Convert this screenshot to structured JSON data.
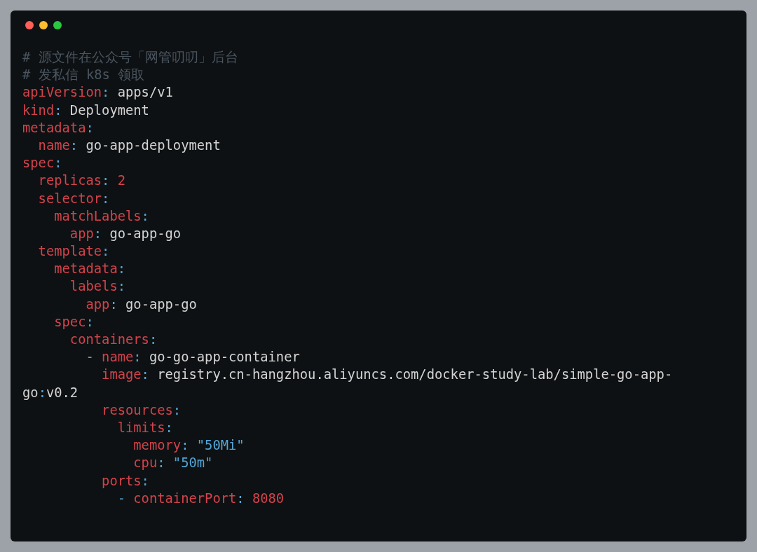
{
  "window": {
    "controls": [
      {
        "color": "#ff5f57"
      },
      {
        "color": "#febc2e"
      },
      {
        "color": "#28c840"
      }
    ]
  },
  "code_lines": [
    [
      {
        "kind": "comment",
        "text": "# 源文件在公众号「网管叨叨」后台"
      }
    ],
    [
      {
        "kind": "comment",
        "text": "# 发私信 k8s 领取"
      }
    ],
    [
      {
        "kind": "key",
        "text": "apiVersion"
      },
      {
        "kind": "punct",
        "text": ": "
      },
      {
        "kind": "value",
        "text": "apps/v1"
      }
    ],
    [
      {
        "kind": "key",
        "text": "kind"
      },
      {
        "kind": "punct",
        "text": ": "
      },
      {
        "kind": "value",
        "text": "Deployment"
      }
    ],
    [
      {
        "kind": "key",
        "text": "metadata"
      },
      {
        "kind": "punct",
        "text": ":"
      }
    ],
    [
      {
        "kind": "key",
        "text": "  name"
      },
      {
        "kind": "punct",
        "text": ": "
      },
      {
        "kind": "value",
        "text": "go-app-deployment"
      }
    ],
    [
      {
        "kind": "key",
        "text": "spec"
      },
      {
        "kind": "punct",
        "text": ":"
      }
    ],
    [
      {
        "kind": "key",
        "text": "  replicas"
      },
      {
        "kind": "punct",
        "text": ": "
      },
      {
        "kind": "number",
        "text": "2"
      }
    ],
    [
      {
        "kind": "key",
        "text": "  selector"
      },
      {
        "kind": "punct",
        "text": ":"
      }
    ],
    [
      {
        "kind": "key",
        "text": "    matchLabels"
      },
      {
        "kind": "punct",
        "text": ":"
      }
    ],
    [
      {
        "kind": "key",
        "text": "      app"
      },
      {
        "kind": "punct",
        "text": ": "
      },
      {
        "kind": "value",
        "text": "go-app-go"
      }
    ],
    [
      {
        "kind": "key",
        "text": "  template"
      },
      {
        "kind": "punct",
        "text": ":"
      }
    ],
    [
      {
        "kind": "key",
        "text": "    metadata"
      },
      {
        "kind": "punct",
        "text": ":"
      }
    ],
    [
      {
        "kind": "key",
        "text": "      labels"
      },
      {
        "kind": "punct",
        "text": ":"
      }
    ],
    [
      {
        "kind": "key",
        "text": "        app"
      },
      {
        "kind": "punct",
        "text": ": "
      },
      {
        "kind": "value",
        "text": "go-app-go"
      }
    ],
    [
      {
        "kind": "key",
        "text": "    spec"
      },
      {
        "kind": "punct",
        "text": ":"
      }
    ],
    [
      {
        "kind": "key",
        "text": "      containers"
      },
      {
        "kind": "punct",
        "text": ":"
      }
    ],
    [
      {
        "kind": "punct",
        "text": "        - "
      },
      {
        "kind": "key",
        "text": "name"
      },
      {
        "kind": "punct",
        "text": ": "
      },
      {
        "kind": "value",
        "text": "go-go-app-container"
      }
    ],
    [
      {
        "kind": "key",
        "text": "          image"
      },
      {
        "kind": "punct",
        "text": ": "
      },
      {
        "kind": "value",
        "text": "registry.cn-hangzhou.aliyuncs.com/docker-study-lab/simple-go-app-"
      }
    ],
    [
      {
        "kind": "value",
        "text": "go"
      },
      {
        "kind": "punct",
        "text": ":"
      },
      {
        "kind": "value",
        "text": "v0.2"
      }
    ],
    [
      {
        "kind": "key",
        "text": "          resources"
      },
      {
        "kind": "punct",
        "text": ":"
      }
    ],
    [
      {
        "kind": "key",
        "text": "            limits"
      },
      {
        "kind": "punct",
        "text": ":"
      }
    ],
    [
      {
        "kind": "key",
        "text": "              memory"
      },
      {
        "kind": "punct",
        "text": ": "
      },
      {
        "kind": "string",
        "text": "\"50Mi\""
      }
    ],
    [
      {
        "kind": "key",
        "text": "              cpu"
      },
      {
        "kind": "punct",
        "text": ": "
      },
      {
        "kind": "string",
        "text": "\"50m\""
      }
    ],
    [
      {
        "kind": "key",
        "text": "          ports"
      },
      {
        "kind": "punct",
        "text": ":"
      }
    ],
    [
      {
        "kind": "punct",
        "text": "            - "
      },
      {
        "kind": "key",
        "text": "containerPort"
      },
      {
        "kind": "punct",
        "text": ": "
      },
      {
        "kind": "number",
        "text": "8080"
      }
    ]
  ]
}
